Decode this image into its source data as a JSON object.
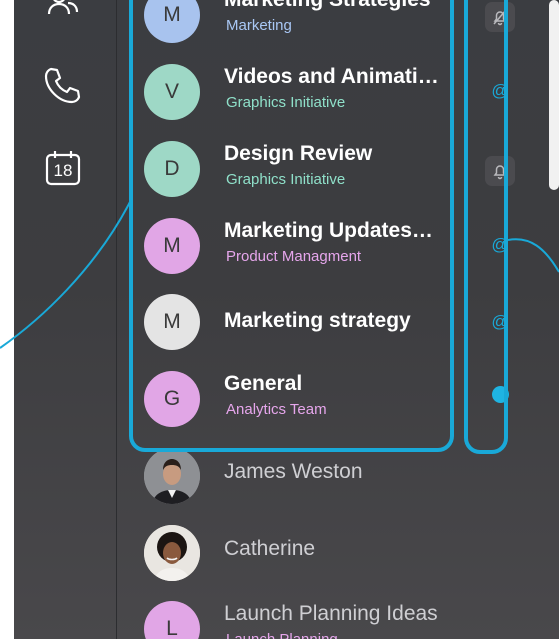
{
  "rail": {
    "icons": [
      "contacts-icon",
      "phone-icon",
      "calendar-icon"
    ],
    "calendar_day": "18",
    "badge_color": "#e8533f"
  },
  "conversations": [
    {
      "initial": "M",
      "title": "Marketing Strategies",
      "subtitle": "Marketing",
      "avatar_color": "#a8c3ee",
      "subtitle_color": "#a9c8f5"
    },
    {
      "initial": "V",
      "title": "Videos and Animati…",
      "subtitle": "Graphics Initiative",
      "avatar_color": "#9ed8c6",
      "subtitle_color": "#8fe0c9"
    },
    {
      "initial": "D",
      "title": "Design Review",
      "subtitle": "Graphics Initiative",
      "avatar_color": "#9ed8c6",
      "subtitle_color": "#8fe0c9"
    },
    {
      "initial": "M",
      "title": "Marketing Updates…",
      "subtitle": "Product Managment",
      "avatar_color": "#e1a6e6",
      "subtitle_color": "#e6a6ec"
    },
    {
      "initial": "M",
      "title": "Marketing strategy",
      "subtitle": "",
      "avatar_color": "#e4e4e4",
      "subtitle_color": "#ffffff"
    },
    {
      "initial": "G",
      "title": "General",
      "subtitle": "Analytics Team",
      "avatar_color": "#e1a6e6",
      "subtitle_color": "#e6a6ec"
    },
    {
      "initial": "",
      "title": "James Weston",
      "subtitle": "",
      "avatar_color": "#9a9ca0",
      "subtitle_color": "#ffffff"
    },
    {
      "initial": "",
      "title": "Catherine",
      "subtitle": "",
      "avatar_color": "#d8d3cc",
      "subtitle_color": "#ffffff"
    },
    {
      "initial": "L",
      "title": "Launch Planning Ideas",
      "subtitle": "Launch Planning",
      "avatar_color": "#e1a6e6",
      "subtitle_color": "#e6a6ec"
    }
  ],
  "status": {
    "at_symbol": "@",
    "accent_color": "#19a9d8",
    "items": [
      "bell-off-icon",
      "mention-icon",
      "bell-icon",
      "mention-icon",
      "mention-icon",
      "unread-dot"
    ]
  }
}
